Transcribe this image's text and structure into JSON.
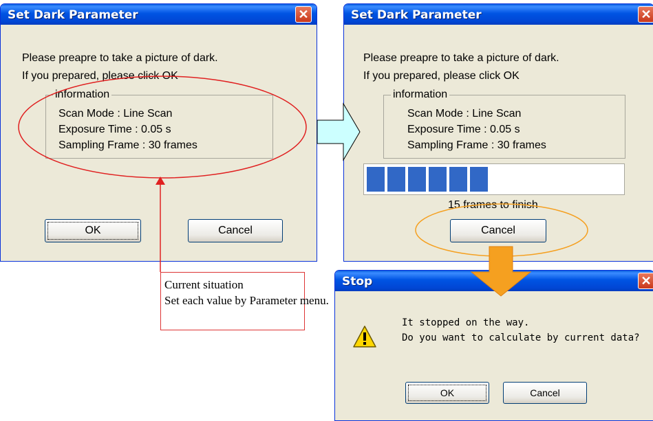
{
  "left_dialog": {
    "title": "Set Dark Parameter",
    "line1": "Please preapre to take a picture of dark.",
    "line2": "If you prepared, please click OK",
    "group_label": "information",
    "scan_mode": "Scan Mode : Line Scan",
    "exposure": "Exposure Time : 0.05 s",
    "sampling": "Sampling Frame : 30 frames",
    "ok_label": "OK",
    "cancel_label": "Cancel"
  },
  "right_dialog": {
    "title": "Set Dark Parameter",
    "line1": "Please preapre to take a picture of dark.",
    "line2": "If you prepared, please click OK",
    "group_label": "information",
    "scan_mode": "Scan Mode : Line Scan",
    "exposure": "Exposure Time : 0.05 s",
    "sampling": "Sampling Frame : 30 frames",
    "progress_status": "15 frames to finish",
    "progress_fraction": 0.5,
    "cancel_label": "Cancel"
  },
  "stop_dialog": {
    "title": "Stop",
    "line1": "It stopped on the way.",
    "line2": "Do you want to calculate by current data?",
    "ok_label": "OK",
    "cancel_label": "Cancel"
  },
  "callout": {
    "line1": "Current situation",
    "line2": "Set each value by Parameter menu."
  },
  "colors": {
    "annotation_red": "#e02020",
    "annotation_orange": "#f5a020",
    "arrow_fill": "#ccffff",
    "progress_blue": "#3168c6"
  }
}
